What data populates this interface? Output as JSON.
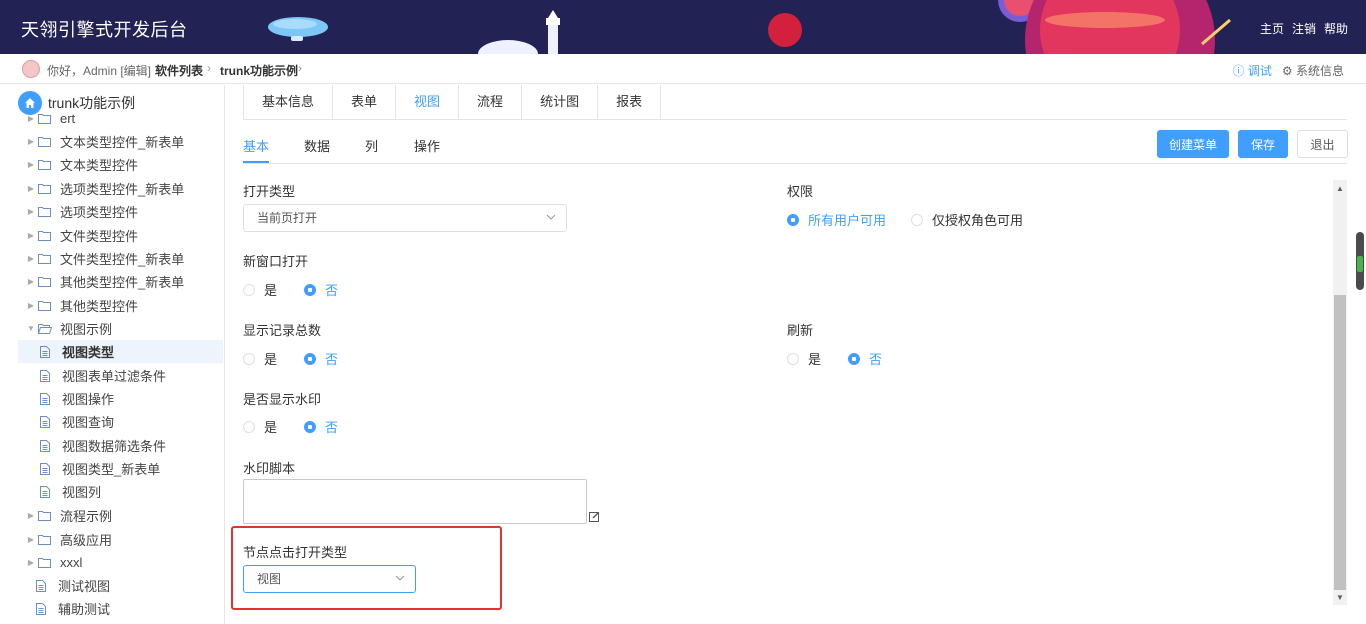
{
  "header": {
    "title": "天翎引擎式开发后台",
    "links": [
      "主页",
      "注销",
      "帮助"
    ]
  },
  "crumbbar": {
    "greeting": "你好，Admin [编辑]",
    "crumbs": [
      "软件列表",
      "trunk功能示例"
    ],
    "debug": "调试",
    "sysinfo": "系统信息"
  },
  "sidebar": {
    "root": "trunk功能示例",
    "items": [
      {
        "label": "ert",
        "type": "folder"
      },
      {
        "label": "文本类型控件_新表单",
        "type": "folder"
      },
      {
        "label": "文本类型控件",
        "type": "folder"
      },
      {
        "label": "选项类型控件_新表单",
        "type": "folder"
      },
      {
        "label": "选项类型控件",
        "type": "folder"
      },
      {
        "label": "文件类型控件",
        "type": "folder"
      },
      {
        "label": "文件类型控件_新表单",
        "type": "folder"
      },
      {
        "label": "其他类型控件_新表单",
        "type": "folder"
      },
      {
        "label": "其他类型控件",
        "type": "folder"
      },
      {
        "label": "视图示例",
        "type": "folder-open"
      },
      {
        "label": "视图类型",
        "type": "file"
      },
      {
        "label": "视图表单过滤条件",
        "type": "file"
      },
      {
        "label": "视图操作",
        "type": "file"
      },
      {
        "label": "视图查询",
        "type": "file"
      },
      {
        "label": "视图数据筛选条件",
        "type": "file"
      },
      {
        "label": "视图类型_新表单",
        "type": "file"
      },
      {
        "label": "视图列",
        "type": "file"
      },
      {
        "label": "流程示例",
        "type": "folder"
      },
      {
        "label": "高级应用",
        "type": "folder"
      },
      {
        "label": "xxxl",
        "type": "folder"
      },
      {
        "label": "测试视图",
        "type": "file"
      },
      {
        "label": "辅助测试",
        "type": "file"
      }
    ]
  },
  "main_tabs": [
    "基本信息",
    "表单",
    "视图",
    "流程",
    "统计图",
    "报表"
  ],
  "sub_tabs": [
    "基本",
    "数据",
    "列",
    "操作"
  ],
  "buttons": {
    "create_menu": "创建菜单",
    "save": "保存",
    "exit": "退出"
  },
  "form": {
    "open_type": {
      "label": "打开类型",
      "value": "当前页打开"
    },
    "permission": {
      "label": "权限",
      "options": [
        "所有用户可用",
        "仅授权角色可用"
      ],
      "selected": "所有用户可用"
    },
    "new_window": {
      "label": "新窗口打开",
      "options": [
        "是",
        "否"
      ],
      "selected": "否"
    },
    "show_total": {
      "label": "显示记录总数",
      "options": [
        "是",
        "否"
      ],
      "selected": "否"
    },
    "refresh": {
      "label": "刷新",
      "options": [
        "是",
        "否"
      ],
      "selected": "否"
    },
    "watermark": {
      "label": "是否显示水印",
      "options": [
        "是",
        "否"
      ],
      "selected": "否"
    },
    "watermark_script": {
      "label": "水印脚本",
      "value": ""
    },
    "node_click": {
      "label": "节点点击打开类型",
      "value": "视图"
    }
  },
  "colors": {
    "header_bg": "#232254",
    "accent": "#409eff",
    "highlight": "#e3332e"
  }
}
